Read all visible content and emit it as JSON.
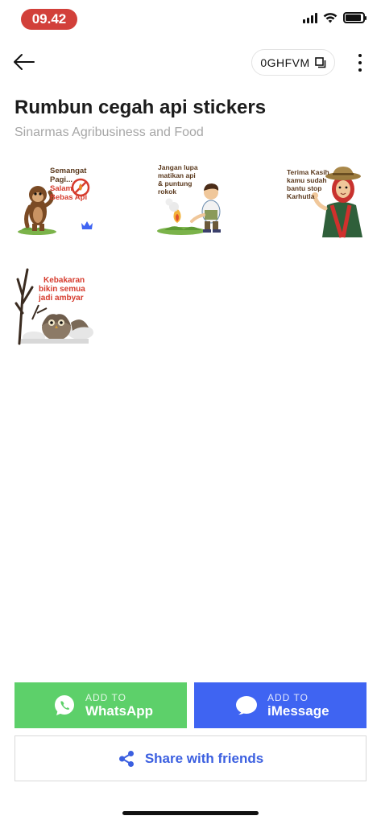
{
  "status_bar": {
    "time": "09.42",
    "battery_level": 0.9
  },
  "header": {
    "pack_code": "0GHFVM"
  },
  "pack": {
    "title": "Rumbun cegah api stickers",
    "publisher": "Sinarmas Agribusiness and Food"
  },
  "stickers": [
    {
      "lines": [
        "Semangat",
        "Pagi...",
        "Salam",
        "Bebas Api"
      ]
    },
    {
      "lines": [
        "Jangan lupa",
        "matikan api",
        "& puntung",
        "rokok"
      ]
    },
    {
      "lines": [
        "Terima Kasih",
        "kamu sudah",
        "bantu stop",
        "Karhutla"
      ]
    },
    {
      "lines": [
        "Kebakaran",
        "bikin semua",
        "jadi ambyar"
      ]
    }
  ],
  "actions": {
    "whatsapp": {
      "small": "ADD TO",
      "big": "WhatsApp"
    },
    "imessage": {
      "small": "ADD TO",
      "big": "iMessage"
    },
    "share": "Share with friends"
  },
  "colors": {
    "whatsapp": "#5dd06a",
    "imessage": "#3f64f2",
    "share_text": "#3b5fe0",
    "time_pill": "#d2403a"
  }
}
